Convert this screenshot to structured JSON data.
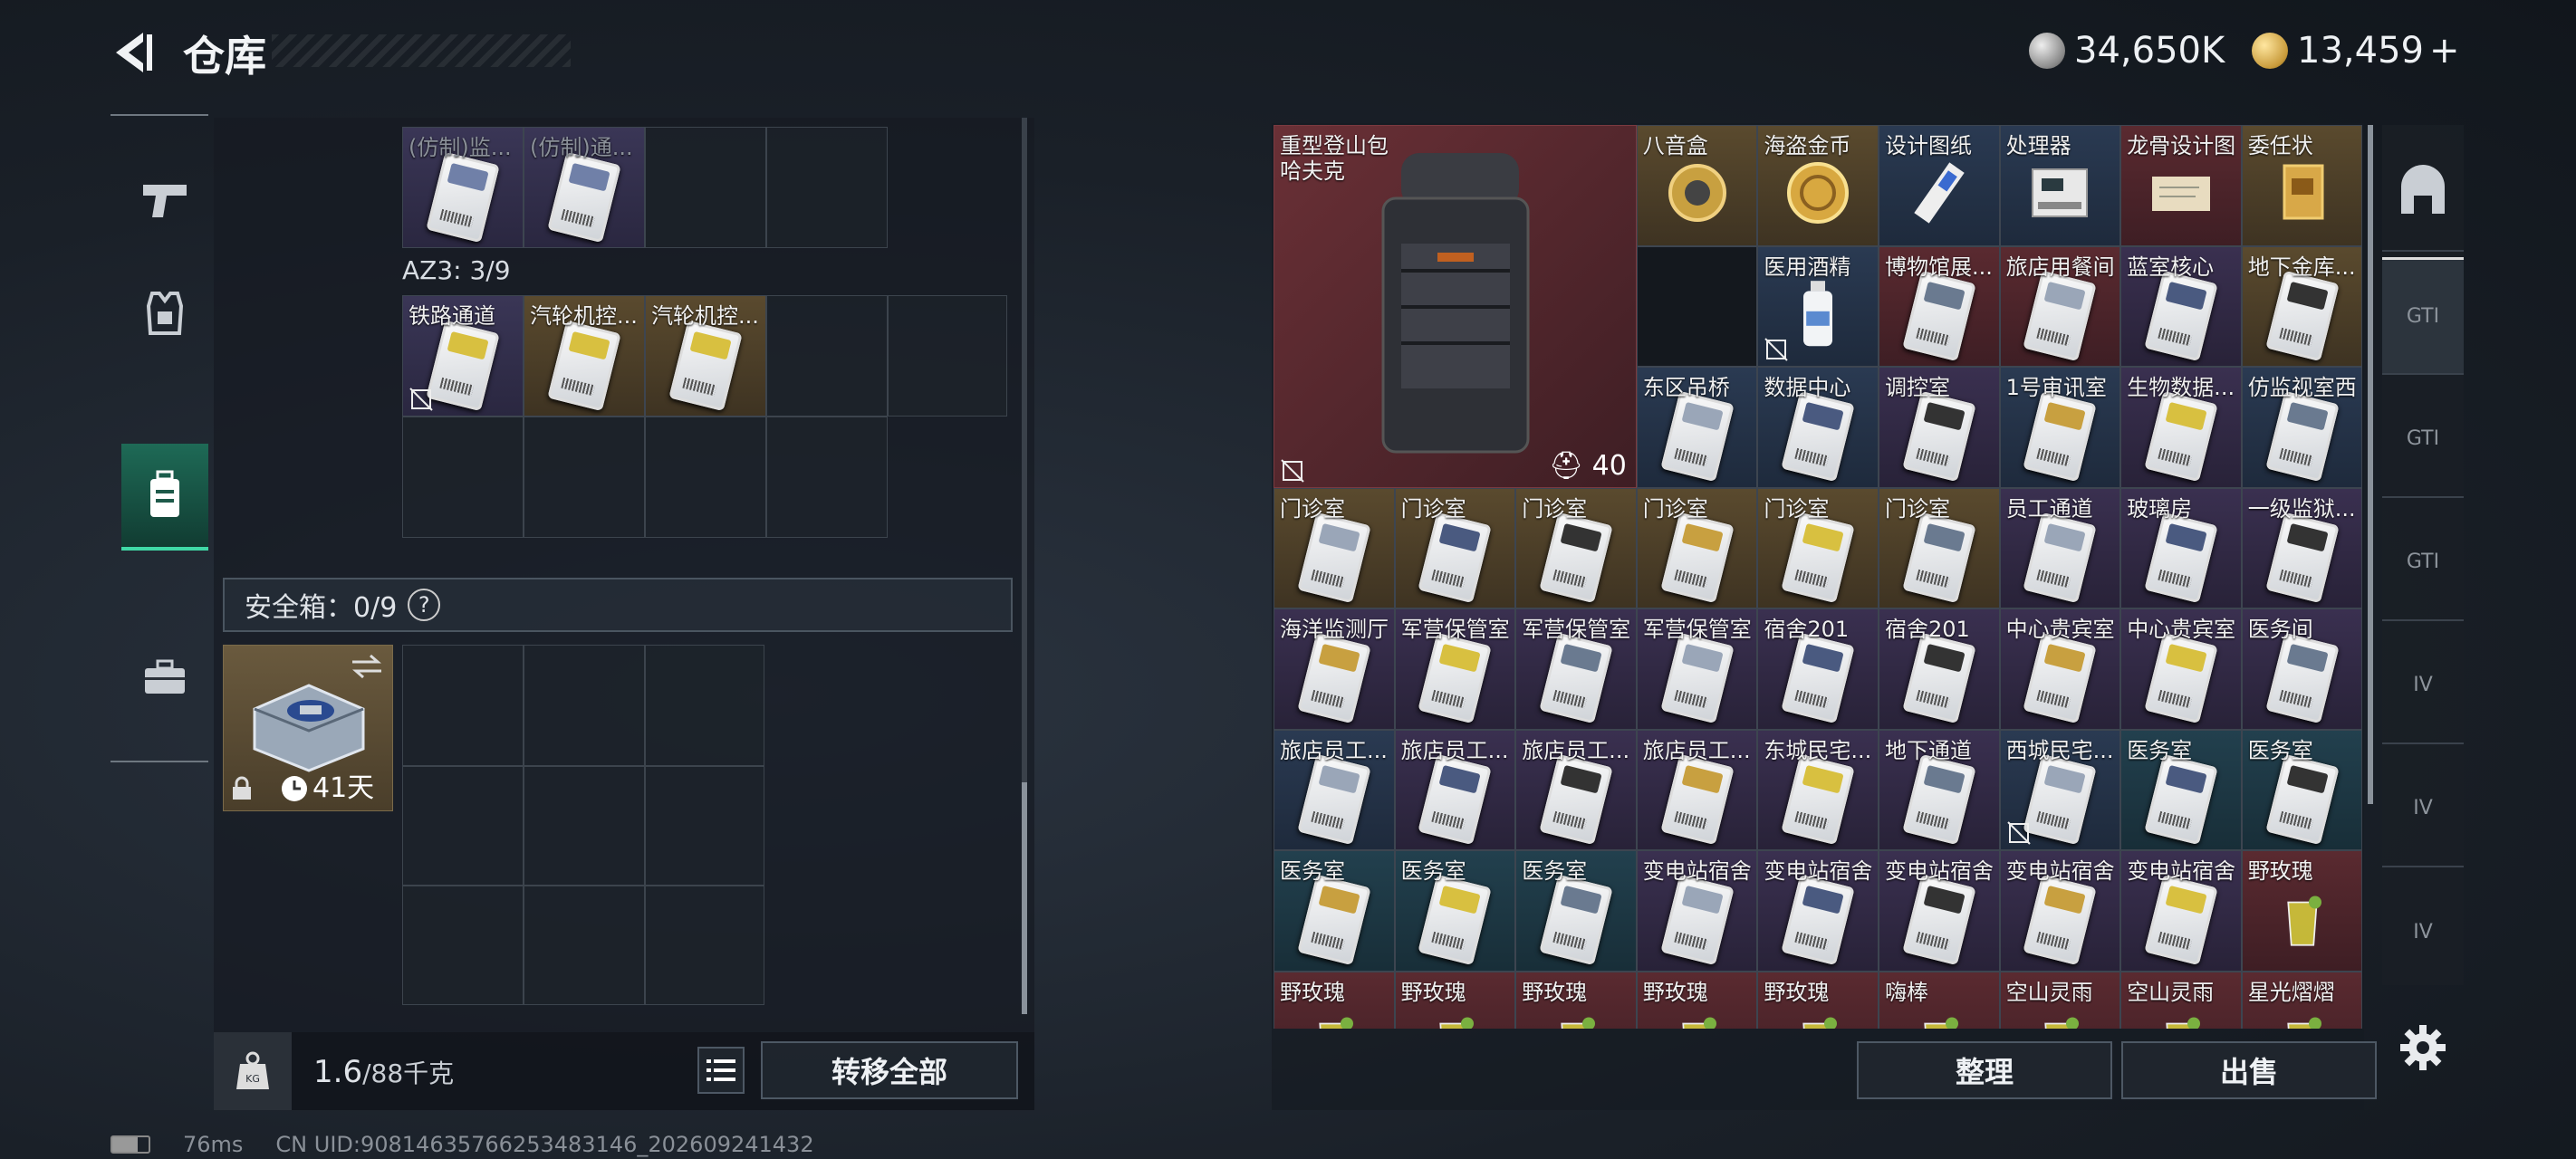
{
  "header": {
    "title": "仓库"
  },
  "currency": {
    "silver": "34,650K",
    "gold": "13,459",
    "plus": "+"
  },
  "left": {
    "top_items": [
      {
        "label": "(仿制)监..."
      },
      {
        "label": "(仿制)通..."
      }
    ],
    "az3": {
      "label": "AZ3: 3/9"
    },
    "az3_items": [
      {
        "label": "铁路通道"
      },
      {
        "label": "汽轮机控..."
      },
      {
        "label": "汽轮机控..."
      }
    ],
    "safebox": {
      "label": "安全箱：0/9",
      "help": "?"
    },
    "safebox_item": {
      "days": "41天"
    },
    "weight": {
      "current": "1.6",
      "max": "/88千克"
    },
    "transfer_all": "转移全部"
  },
  "backpack": {
    "name_line1": "重型登山包",
    "name_line2": "哈夫克",
    "capacity": "40"
  },
  "right": {
    "grid": [
      [
        "",
        "",
        "",
        "八音盒",
        "海盗金币",
        "设计图纸",
        "处理器",
        "龙骨设计图",
        "委任状"
      ],
      [
        "",
        "",
        "",
        "",
        "医用酒精",
        "博物馆展...",
        "旅店用餐间",
        "蓝室核心",
        "地下金库..."
      ],
      [
        "",
        "",
        "",
        "东区吊桥",
        "数据中心",
        "调控室",
        "1号审讯室",
        "生物数据...",
        "仿监视室西"
      ],
      [
        "门诊室",
        "门诊室",
        "门诊室",
        "门诊室",
        "门诊室",
        "门诊室",
        "员工通道",
        "玻璃房",
        "一级监狱..."
      ],
      [
        "海洋监测厅",
        "军营保管室",
        "军营保管室",
        "军营保管室",
        "宿舍201",
        "宿舍201",
        "中心贵宾室",
        "中心贵宾室",
        "医务间"
      ],
      [
        "旅店员工...",
        "旅店员工...",
        "旅店员工...",
        "旅店员工...",
        "东城民宅...",
        "地下通道",
        "西城民宅...",
        "医务室",
        "医务室"
      ],
      [
        "医务室",
        "医务室",
        "医务室",
        "变电站宿舍",
        "变电站宿舍",
        "变电站宿舍",
        "变电站宿舍",
        "变电站宿舍",
        "野玫瑰"
      ],
      [
        "野玫瑰",
        "野玫瑰",
        "野玫瑰",
        "野玫瑰",
        "野玫瑰",
        "嗨棒",
        "空山灵雨",
        "空山灵雨",
        "星光熠熠"
      ]
    ],
    "organize": "整理",
    "sell": "出售"
  },
  "right_tabs": [
    "",
    "GTI",
    "GTI",
    "GTI",
    "IV",
    "IV",
    "IV"
  ],
  "footer": {
    "ping": "76ms",
    "uid": "CN UID:90814635766253483146_202609241432"
  },
  "colors": {
    "accent_green": "#40d9a6",
    "cell_red": "#5a2a30",
    "cell_blue": "#2a3a52",
    "cell_purple": "#3a3050",
    "cell_gold": "#5a4a2e",
    "cell_teal": "#22404e"
  }
}
